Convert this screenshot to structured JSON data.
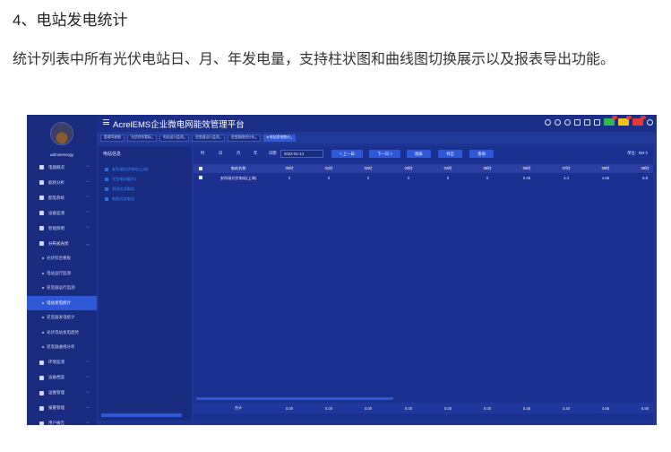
{
  "doc": {
    "heading": "4、电站发电统计",
    "paragraph": "统计列表中所有光伏电站日、月、年发电量，支持柱状图和曲线图切换展示以及报表导出功能。"
  },
  "app": {
    "title": "AcrelEMS企业微电网能效管理平台",
    "user": {
      "name": "adminenergy"
    },
    "header_icons": [
      "globe-icon",
      "search-icon",
      "refresh-icon",
      "fullscreen-icon",
      "screen-icon",
      "shirt-icon",
      "bell-badge",
      "alert-badge",
      "warning-badge",
      "user-icon"
    ],
    "sidebar": [
      {
        "label": "电能概况",
        "icon": "chart-icon",
        "expandable": true
      },
      {
        "label": "能耗分析",
        "icon": "analysis-icon",
        "expandable": true
      },
      {
        "label": "配电系统",
        "icon": "distribution-icon",
        "expandable": true
      },
      {
        "label": "设备监测",
        "icon": "monitor-icon",
        "expandable": true
      },
      {
        "label": "智能照明",
        "icon": "light-icon",
        "expandable": true
      },
      {
        "label": "分布式光伏",
        "icon": "solar-icon",
        "expandable": true,
        "open": true
      },
      {
        "label": "光伏综合看板",
        "sub": true
      },
      {
        "label": "电站运行监测",
        "sub": true
      },
      {
        "label": "逆变器运行监测",
        "sub": true
      },
      {
        "label": "电站发电统计",
        "sub": true,
        "active": true
      },
      {
        "label": "逆变器发电统计",
        "sub": true
      },
      {
        "label": "光伏电站发电趋势",
        "sub": true
      },
      {
        "label": "逆变器曲线分析",
        "sub": true
      },
      {
        "label": "环境监测",
        "icon": "env-icon",
        "expandable": true
      },
      {
        "label": "设备档案",
        "icon": "archive-icon",
        "expandable": true
      },
      {
        "label": "运维管理",
        "icon": "maintenance-icon",
        "expandable": true
      },
      {
        "label": "报警管理",
        "icon": "alarm-icon",
        "expandable": true
      },
      {
        "label": "用户报告",
        "icon": "report-icon",
        "expandable": true
      }
    ],
    "tabs": [
      {
        "label": "管理驾驶舱",
        "closable": false
      },
      {
        "label": "光伏综合看板",
        "closable": true
      },
      {
        "label": "电站运行监测",
        "closable": true
      },
      {
        "label": "逆变器运行监测",
        "closable": true
      },
      {
        "label": "逆变器曲线分析",
        "closable": true
      },
      {
        "label": "● 电站发电统计",
        "closable": true,
        "active": true
      }
    ],
    "tree": {
      "title": "电站信息",
      "items": [
        "安科瑞光伏电站(上海)",
        "光伏电站编号1",
        "测试光伏电站",
        "新能光伏电站"
      ]
    },
    "toolbar": {
      "periods": [
        "时",
        "日",
        "月",
        "年"
      ],
      "date_label": "日期",
      "date_value": "2022-01-13",
      "prev": "< 上一日",
      "next": "下一日 >",
      "chart": "图表",
      "export": "导出",
      "query": "查询",
      "unit": "单位：kW·h"
    },
    "table": {
      "columns": [
        "电站名称",
        "00时",
        "01时",
        "02时",
        "03时",
        "04时",
        "05时",
        "06时",
        "07时",
        "08时",
        "09时"
      ],
      "rows": [
        [
          "安科瑞光伏电站(上海)",
          "0",
          "0",
          "0",
          "0",
          "0",
          "0",
          "0.45",
          "3.4",
          "4.65",
          "6.8"
        ]
      ],
      "total": [
        "合计",
        "0.00",
        "0.00",
        "0.00",
        "0.00",
        "0.00",
        "0.00",
        "0.45",
        "3.40",
        "4.65",
        "6.80"
      ]
    },
    "colors": {
      "bg": "#1f3592",
      "sidebar": "#1a2c80",
      "accent": "#2e58d8",
      "link": "#3a8df3",
      "badge_green": "#2fb84f",
      "badge_yellow": "#f1c21b",
      "badge_red": "#e43838"
    }
  }
}
